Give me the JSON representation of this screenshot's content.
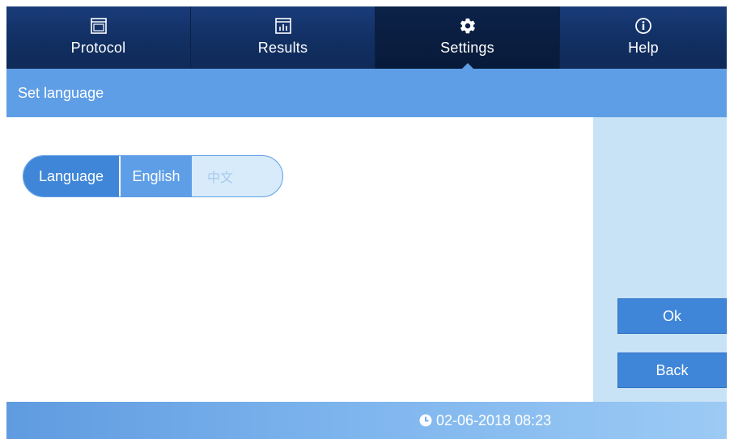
{
  "nav": {
    "tabs": [
      {
        "label": "Protocol",
        "icon": "window-icon"
      },
      {
        "label": "Results",
        "icon": "bar-chart-icon"
      },
      {
        "label": "Settings",
        "icon": "gear-icon"
      },
      {
        "label": "Help",
        "icon": "info-icon"
      }
    ],
    "active": "Settings"
  },
  "header": {
    "title": "Set language"
  },
  "language": {
    "label": "Language",
    "options": [
      "English",
      "中文"
    ],
    "selected": "English"
  },
  "buttons": {
    "ok": "Ok",
    "back": "Back"
  },
  "footer": {
    "datetime": "02-06-2018 08:23",
    "icon": "clock-icon"
  },
  "colors": {
    "nav_bg": "#123064",
    "header_bg": "#5e9ee6",
    "accent": "#3f86d8",
    "panel_bg": "#c8e2f6"
  }
}
